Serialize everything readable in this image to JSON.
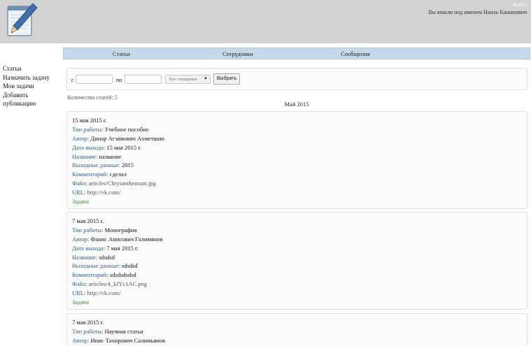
{
  "header": {
    "logout": "Выйти",
    "logged_in": "Вы вошли под именем Наиль Кашапович"
  },
  "sidebar": {
    "items": [
      {
        "label": "Статьи"
      },
      {
        "label": "Назначить задачу"
      },
      {
        "label": "Мои задачи"
      },
      {
        "label": "Добавить"
      },
      {
        "label": "публикацию"
      }
    ]
  },
  "nav": {
    "tabs": [
      {
        "label": "Статьи"
      },
      {
        "label": "Сотрудники"
      },
      {
        "label": "Сообщения"
      }
    ]
  },
  "filter": {
    "from_label": "с",
    "to_label": "по",
    "from_value": "",
    "to_value": "",
    "employee_select": "Все сотрудники",
    "submit": "Выбрать"
  },
  "count_text": "Количество статей: 5",
  "month_heading": "Май 2015",
  "labels": {
    "type": "Тип работы:",
    "author": "Автор:",
    "release_date": "Дата выхода:",
    "title": "Название:",
    "output": "Выходные данные:",
    "comment": "Комментарий:",
    "file": "Файл:",
    "url": "URL:",
    "task": "Задача"
  },
  "articles": [
    {
      "date": "15 мая 2015 г.",
      "type": "Учебное пособие",
      "author": "Динар Агзямович Ахметшин",
      "release_date": "15 мая 2015 г.",
      "title": "название",
      "output": "2015",
      "comment": "сделал",
      "file": "articles/Chrysanthemum.jpg",
      "url": "http://vk.com/"
    },
    {
      "date": "7 мая 2015 г.",
      "type": "Монография",
      "author": "Фанис Анисович Галимянов",
      "release_date": "7 мая 2015 г.",
      "title": "sdsdsd",
      "output": "sdsdsd",
      "comment": "sdsdsdsdsd",
      "file": "articles/4_kIYc1AC.png",
      "url": "http://vk.com/"
    },
    {
      "date": "7 мая 2015 г.",
      "type": "Научная статья",
      "author": "Ииис Тахирович Салимьянов"
    }
  ]
}
